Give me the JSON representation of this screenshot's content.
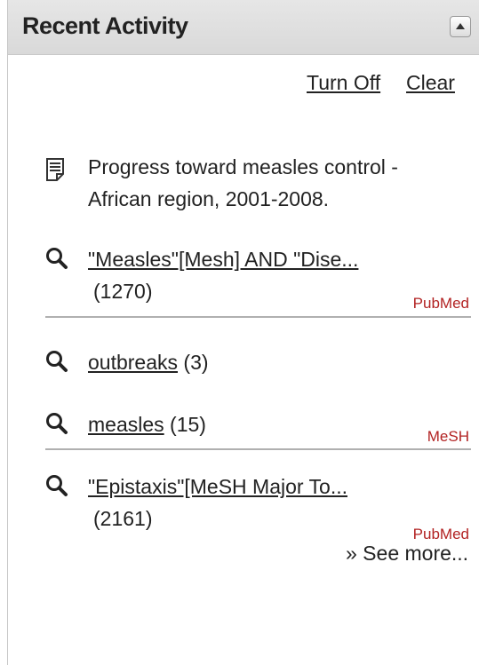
{
  "header": {
    "title": "Recent Activity",
    "collapse_icon": "collapse-up-arrow-icon"
  },
  "actions": {
    "turn_off": "Turn Off",
    "clear": "Clear"
  },
  "items": [
    {
      "type": "document",
      "icon": "document-icon",
      "line1": "Progress toward measles control -",
      "line2": "African region, 2001-2008."
    },
    {
      "type": "search",
      "icon": "search-icon",
      "query": "\"Measles\"[Mesh] AND \"Dise...",
      "count": "(1270)",
      "source": "PubMed"
    },
    {
      "type": "search",
      "icon": "search-icon",
      "query": "outbreaks",
      "count": "(3)"
    },
    {
      "type": "search",
      "icon": "search-icon",
      "query": "measles",
      "count": "(15)",
      "source": "MeSH"
    },
    {
      "type": "search",
      "icon": "search-icon",
      "query": "\"Epistaxis\"[MeSH Major To...",
      "count": "(2161)",
      "source": "PubMed"
    }
  ],
  "footer": {
    "see_more": "» See more..."
  },
  "colors": {
    "header_bg": "#dedede",
    "source_red": "#b22222",
    "divider": "#b0b0b0"
  }
}
